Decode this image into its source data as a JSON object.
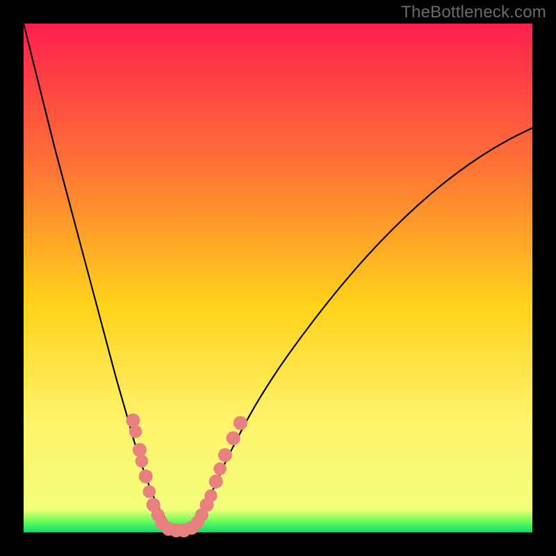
{
  "watermark": {
    "text": "TheBottleneck.com"
  },
  "chart_data": {
    "type": "line",
    "title": "",
    "xlabel": "",
    "ylabel": "",
    "xlim": [
      0,
      100
    ],
    "ylim": [
      0,
      100
    ],
    "grid": false,
    "gradient_stops": [
      {
        "offset": 0.0,
        "color": "#ff1f4e"
      },
      {
        "offset": 0.3,
        "color": "#ff7a33"
      },
      {
        "offset": 0.55,
        "color": "#ffd11a"
      },
      {
        "offset": 0.78,
        "color": "#fff36b"
      },
      {
        "offset": 0.955,
        "color": "#f3ff7a"
      },
      {
        "offset": 0.975,
        "color": "#7dff5a"
      },
      {
        "offset": 1.0,
        "color": "#00e06a"
      }
    ],
    "series": [
      {
        "name": "bottleneck-curve",
        "x": [
          0,
          2,
          4,
          6,
          8,
          10,
          12,
          14,
          16,
          18,
          20,
          22,
          24,
          26,
          28,
          30,
          32,
          34,
          36,
          38,
          40,
          45,
          50,
          55,
          60,
          65,
          70,
          75,
          80,
          85,
          90,
          95,
          100
        ],
        "y": [
          100,
          92,
          84,
          76,
          68.5,
          61,
          53.5,
          46,
          38.5,
          31,
          24,
          17,
          11,
          6,
          2.5,
          0.5,
          0.5,
          2.5,
          6,
          10,
          14.5,
          24,
          32,
          39,
          45.5,
          51.5,
          57,
          62,
          66.5,
          70.5,
          74,
          77,
          79.5
        ]
      }
    ],
    "markers": [
      {
        "x": 21.5,
        "y": 22.0,
        "r": 1.5
      },
      {
        "x": 22.0,
        "y": 19.8,
        "r": 1.3
      },
      {
        "x": 22.8,
        "y": 16.2,
        "r": 1.5
      },
      {
        "x": 23.2,
        "y": 14.0,
        "r": 1.3
      },
      {
        "x": 24.0,
        "y": 11.0,
        "r": 1.5
      },
      {
        "x": 24.7,
        "y": 8.0,
        "r": 1.3
      },
      {
        "x": 25.5,
        "y": 5.4,
        "r": 1.5
      },
      {
        "x": 26.4,
        "y": 3.4,
        "r": 1.4
      },
      {
        "x": 27.2,
        "y": 1.8,
        "r": 1.4
      },
      {
        "x": 28.5,
        "y": 0.7,
        "r": 1.5
      },
      {
        "x": 30.0,
        "y": 0.4,
        "r": 1.5
      },
      {
        "x": 31.5,
        "y": 0.4,
        "r": 1.5
      },
      {
        "x": 33.0,
        "y": 0.9,
        "r": 1.5
      },
      {
        "x": 34.2,
        "y": 2.0,
        "r": 1.4
      },
      {
        "x": 35.0,
        "y": 3.4,
        "r": 1.4
      },
      {
        "x": 36.0,
        "y": 5.4,
        "r": 1.5
      },
      {
        "x": 36.8,
        "y": 7.2,
        "r": 1.3
      },
      {
        "x": 37.8,
        "y": 10.0,
        "r": 1.5
      },
      {
        "x": 38.6,
        "y": 12.5,
        "r": 1.3
      },
      {
        "x": 39.6,
        "y": 15.2,
        "r": 1.5
      },
      {
        "x": 41.2,
        "y": 18.5,
        "r": 1.5
      },
      {
        "x": 42.6,
        "y": 21.5,
        "r": 1.5
      }
    ]
  }
}
